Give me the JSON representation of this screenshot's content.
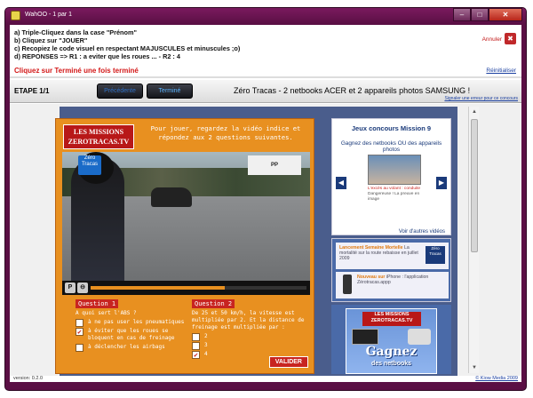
{
  "window": {
    "title": "WahOO - 1 par 1",
    "min_icon": "minimize-icon",
    "max_icon": "maximize-icon",
    "close_icon": "close-icon",
    "min_glyph": "–",
    "max_glyph": "□",
    "close_glyph": "✕"
  },
  "instructions": {
    "lines": [
      "a) Triple-Cliquez dans la case \"Prénom\"",
      "b) Cliquez sur \"JOUER\"",
      "c) Recopiez le code visuel en respectant MAJUSCULES et minuscules ;o)",
      "d) REPONSES => R1 : a eviter que les roues ... - R2 : 4"
    ],
    "red_note": "Cliquez sur Terminé une fois terminé",
    "annuler": "Annuler",
    "annuler_glyph": "✖",
    "reinitialiser": "Réinitialiser"
  },
  "stepbar": {
    "etape": "ETAPE 1/1",
    "prev_label": "Précédente",
    "done_label": "Terminé",
    "title": "Zéro Tracas - 2 netbooks ACER et 2 appareils photos SAMSUNG !",
    "signal": "Signaler une erreur pour ce concours"
  },
  "game": {
    "logo_line1": "LES MISSIONS",
    "logo_line2": "ZEROTRACAS.TV",
    "intro": "Pour jouer, regardez la vidéo indice et répondez aux 2 questions suivantes.",
    "video_sign": "PP",
    "video_badge": "Zéro Tracas",
    "progress_fraction": 0.62,
    "play_glyph": "P",
    "stop_glyph": "⊖",
    "q1": {
      "title": "Question 1",
      "text": "A quoi sert l'ABS ?",
      "options": [
        {
          "label": "à ne pas user les pneumatiques",
          "checked": false
        },
        {
          "label": "à éviter que les roues se bloquent en cas de freinage",
          "checked": true
        },
        {
          "label": "à déclencher les airbags",
          "checked": false
        }
      ]
    },
    "q2": {
      "title": "Question 2",
      "text": "De 25 et 50 km/h, la vitesse est multipliée par 2. Et la distance de freinage est multipliée par :",
      "options": [
        {
          "label": "2",
          "checked": false
        },
        {
          "label": "3",
          "checked": false
        },
        {
          "label": "4",
          "checked": true
        }
      ]
    },
    "checkmark": "✔",
    "valider": "VALIDER"
  },
  "sidebar": {
    "title": "Jeux concours Mission 9",
    "subtitle": "Gagnez des netbooks OU des appareils photos",
    "prev_glyph": "◀",
    "next_glyph": "▶",
    "caption_red": "L'excès au volant : conduite",
    "caption_gray": "Dangereuse ! La preuve en image",
    "voir": "Voir d'autres vidéos",
    "news1_title": "Lancement Semaine Mortelle",
    "news1_text": "La mortalité sur la route rebaisse en juillet 2009",
    "news1_logo": "Zéro Tracas",
    "news2_title": "Nouveau sur",
    "news2_text": "iPhone : l'application Zérotracas.appp"
  },
  "ad": {
    "logo": "LES MISSIONS ZEROTRACAS.TV",
    "gagnez": "Gagnez",
    "sub": "des netbooks"
  },
  "scrollbar": {
    "up_glyph": "▲",
    "down_glyph": "▼"
  },
  "status": {
    "version": "version: 0.2.0",
    "copyright": "© Kiow Media 2009"
  }
}
